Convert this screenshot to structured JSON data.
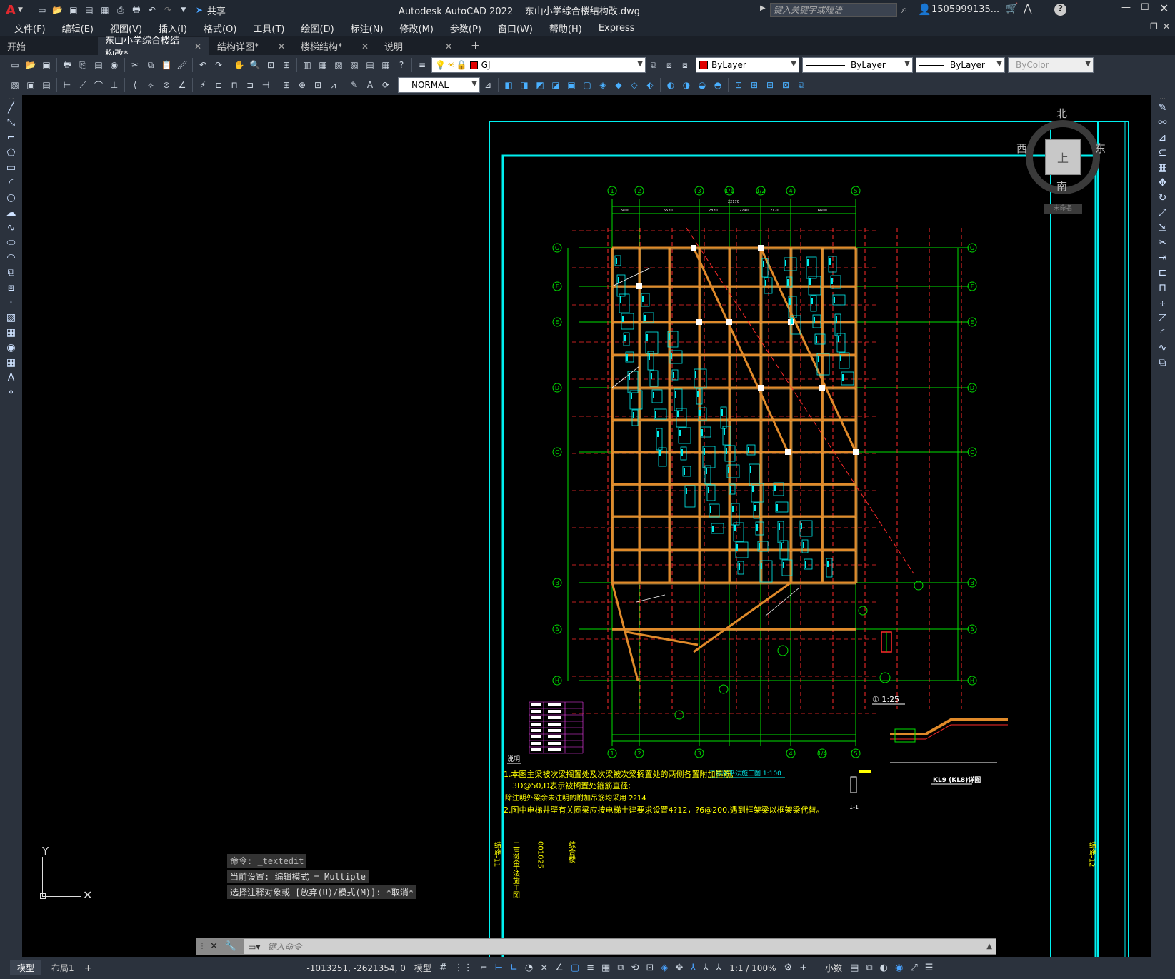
{
  "title_bar": {
    "app_logo": "A",
    "share_label": "共享",
    "window_title": "Autodesk AutoCAD 2022    东山小学综合楼结构改.dwg",
    "search_placeholder": "键入关键字或短语",
    "user_name": "1505999135...",
    "help": "?"
  },
  "menu": [
    "文件(F)",
    "编辑(E)",
    "视图(V)",
    "插入(I)",
    "格式(O)",
    "工具(T)",
    "绘图(D)",
    "标注(N)",
    "修改(M)",
    "参数(P)",
    "窗口(W)",
    "帮助(H)",
    "Express"
  ],
  "tabs": [
    {
      "label": "开始",
      "active": false,
      "closable": false
    },
    {
      "label": "东山小学综合楼结构改*",
      "active": true,
      "closable": true
    },
    {
      "label": "结构详图*",
      "active": false,
      "closable": true
    },
    {
      "label": "楼梯结构*",
      "active": false,
      "closable": true
    },
    {
      "label": "说明",
      "active": false,
      "closable": true
    }
  ],
  "toolbar": {
    "layer_name": "GJ",
    "color": "ByLayer",
    "linetype": "ByLayer",
    "lineweight": "ByLayer",
    "plotstyle": "ByColor",
    "dimstyle": "NORMAL"
  },
  "viewcube": {
    "north": "北",
    "south": "南",
    "east": "东",
    "west": "西",
    "top": "上",
    "wcs": "未命名"
  },
  "ucs": {
    "y": "Y",
    "x": "X"
  },
  "command": {
    "history": [
      "命令: _textedit",
      "当前设置: 编辑模式 = Multiple",
      "选择注释对象或 [放弃(U)/模式(M)]: *取消*"
    ],
    "placeholder": "键入命令"
  },
  "drawing": {
    "grid_top": [
      "1",
      "2",
      "3",
      "1/1",
      "1/2",
      "4",
      "5"
    ],
    "grid_bottom": [
      "1",
      "2",
      "3",
      "4",
      "1/4",
      "5"
    ],
    "grid_rows": [
      "G",
      "F",
      "E",
      "D",
      "C",
      "B",
      "A",
      "H"
    ],
    "top_dims": [
      "2400",
      "5570",
      "2820",
      "2790",
      "2170",
      "6600"
    ],
    "top_total": "22170",
    "notes_title": "说明",
    "note1": "1.本图主梁被次梁搁置处及次梁被次梁搁置处的两侧各置附加箍筋,",
    "note1_b": "3D@50,D表示被搁置处箍筋直径;",
    "note1_c": "除注明外梁余未注明的附加吊筋均采用  2?14",
    "note2": "2.图中电梯井壁有关圈梁应按电梯土建要求设置4?12，?6@200,遇到框架梁以框架梁代替。",
    "plan_title": "二层梁平法施工图 1:100",
    "detail1": "① 1:25",
    "detail_kl9": "KL9 (KL8)详图",
    "detail_11": "1-1",
    "title_block": [
      "结施-11",
      "二层梁平法施工图",
      "001025",
      "综合楼"
    ],
    "title_block_right": "结施-12"
  },
  "status": {
    "tabs": [
      "模型",
      "布局1"
    ],
    "coords": "-1013251, -2621354, 0",
    "model": "模型",
    "scale": "1:1 / 100%",
    "units": "小数"
  },
  "colors": {
    "grid_green": "#00e000",
    "beam": "#e08a2a",
    "cyan": "#00f0f0",
    "red": "#ff2a2a",
    "yellow": "#ffff00",
    "magenta": "#ff40ff",
    "white": "#ffffff"
  }
}
